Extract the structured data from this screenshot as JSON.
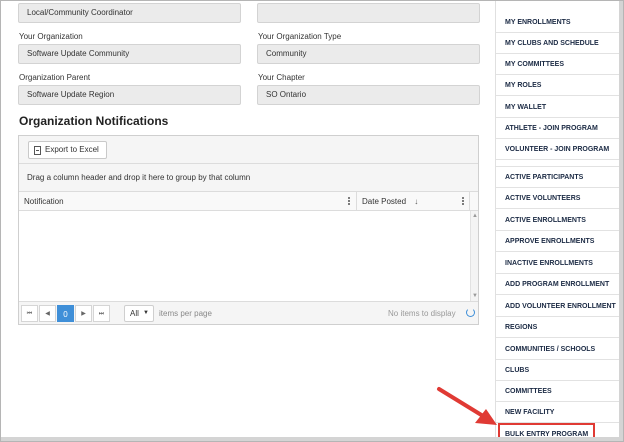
{
  "profile": {
    "role_value": "Local/Community Coordinator",
    "org_label": "Your Organization",
    "org_value": "Software Update Community",
    "org_type_label": "Your Organization Type",
    "org_type_value": "Community",
    "org_parent_label": "Organization Parent",
    "org_parent_value": "Software Update Region",
    "chapter_label": "Your Chapter",
    "chapter_value": "SO Ontario"
  },
  "notifications": {
    "title": "Organization Notifications",
    "export_label": "Export to Excel",
    "group_hint": "Drag a column header and drop it here to group by that column",
    "columns": [
      "Notification",
      "Date Posted"
    ],
    "sort_indicator": "↓",
    "pager": {
      "first": "⏮",
      "prev": "◀",
      "current_page": "0",
      "next": "▶",
      "last": "⏭",
      "page_size": "All",
      "per_page_label": "items per page",
      "status": "No items to display"
    }
  },
  "sidebar": {
    "items": [
      "MY ENROLLMENTS",
      "MY CLUBS AND SCHEDULE",
      "MY COMMITTEES",
      "MY ROLES",
      "MY WALLET",
      "ATHLETE - JOIN PROGRAM",
      "VOLUNTEER - JOIN PROGRAM",
      "ACTIVE PARTICIPANTS",
      "ACTIVE VOLUNTEERS",
      "ACTIVE ENROLLMENTS",
      "APPROVE ENROLLMENTS",
      "INACTIVE ENROLLMENTS",
      "ADD PROGRAM ENROLLMENT",
      "ADD VOLUNTEER ENROLLMENT",
      "REGIONS",
      "COMMUNITIES / SCHOOLS",
      "CLUBS",
      "COMMITTEES",
      "NEW FACILITY",
      "BULK ENTRY PROGRAM"
    ],
    "highlighted": "BULK ENTRY PROGRAM"
  },
  "colors": {
    "accent": "#3f8fd8",
    "highlight": "#e03a34",
    "nav_text": "#1b2a44"
  }
}
